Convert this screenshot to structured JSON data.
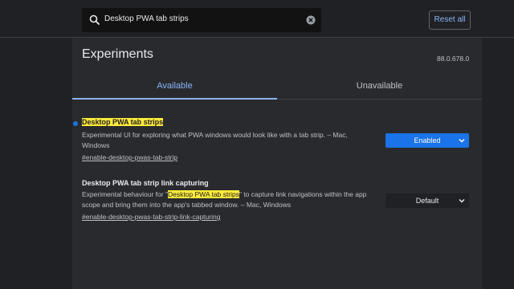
{
  "search": {
    "query": "Desktop PWA tab strips",
    "icon": "search-icon",
    "clear_icon": "clear-icon"
  },
  "reset_label": "Reset all",
  "page": {
    "title": "Experiments",
    "version": "88.0.678.0"
  },
  "tabs": [
    {
      "label": "Available",
      "active": true
    },
    {
      "label": "Unavailable",
      "active": false
    }
  ],
  "experiments": [
    {
      "title": "Desktop PWA tab strips",
      "description": "Experimental UI for exploring what PWA windows would look like with a tab strip. – Mac, Windows",
      "link": "#enable-desktop-pwas-tab-strip",
      "value": "Enabled",
      "modified": true
    },
    {
      "title": "Desktop PWA tab strip link capturing",
      "description_before": "Experimental behaviour for \"",
      "description_highlight": "Desktop PWA tab strips",
      "description_after": "\" to capture link navigations within the app scope and bring them into the app's tabbed window. – Mac, Windows",
      "link": "#enable-desktop-pwas-tab-strip-link-capturing",
      "value": "Default",
      "modified": false
    }
  ],
  "colors": {
    "accent": "#8ab4f8",
    "enabled_bg": "#1a73e8",
    "highlight": "#ffeb3b",
    "background": "#202124",
    "panel": "#292a2d"
  }
}
